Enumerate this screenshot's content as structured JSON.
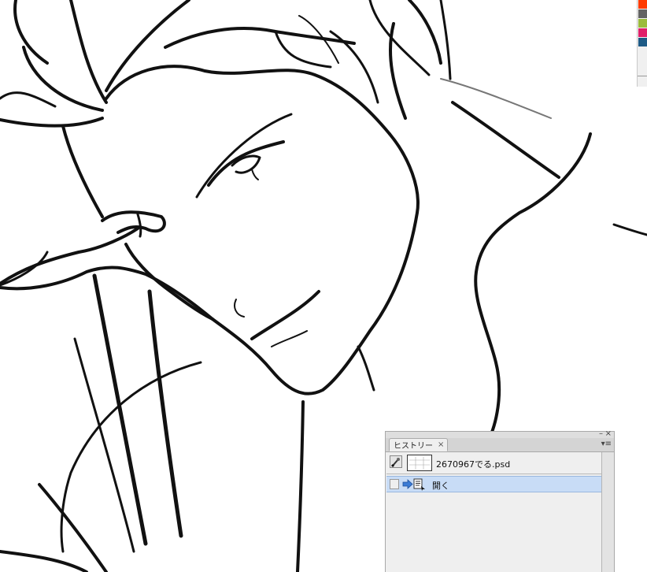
{
  "history_panel": {
    "tab_label": "ヒストリー",
    "tab_close_glyph": "×",
    "minimize_glyph": "–",
    "close_glyph": "×",
    "menu_glyph": "▾≡",
    "snapshot_label": "2670967でる.psd",
    "state_label": "開く",
    "selection_color": "#c8dcf6"
  },
  "swatches": [
    "#ff3b00",
    "#636363",
    "#9bbb3c",
    "#e0206a",
    "#1e5b86"
  ]
}
